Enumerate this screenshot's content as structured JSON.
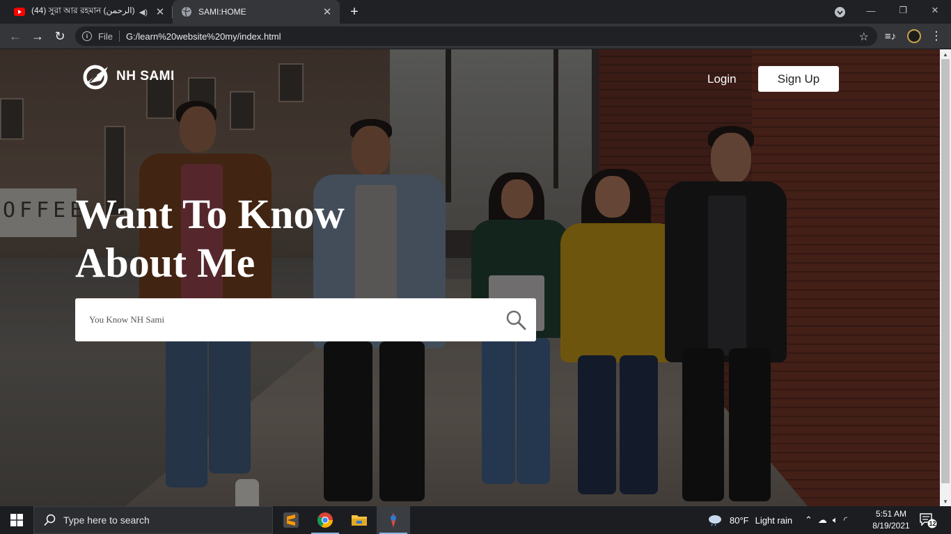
{
  "browser": {
    "tabs": [
      {
        "title": "(44) সুরা আর রহমান (الرحمن)",
        "active": false
      },
      {
        "title": "SAMI:HOME",
        "active": true
      }
    ],
    "new_tab_label": "+",
    "address": {
      "scheme_label": "File",
      "url": "G:/learn%20website%20my/index.html"
    }
  },
  "site": {
    "brand": "NH SAMI",
    "nav": {
      "login": "Login",
      "signup": "Sign Up"
    },
    "hero": {
      "line1": "Want To Know",
      "line2": "About Me"
    },
    "search": {
      "placeholder": "You Know NH Sami"
    }
  },
  "taskbar": {
    "search_placeholder": "Type here to search",
    "apps": [
      "sublime-text",
      "google-chrome",
      "file-explorer",
      "paint-app"
    ],
    "weather": {
      "temp": "80°F",
      "condition": "Light rain"
    },
    "clock": {
      "time": "5:51 AM",
      "date": "8/19/2021"
    },
    "notification_count": "12"
  }
}
